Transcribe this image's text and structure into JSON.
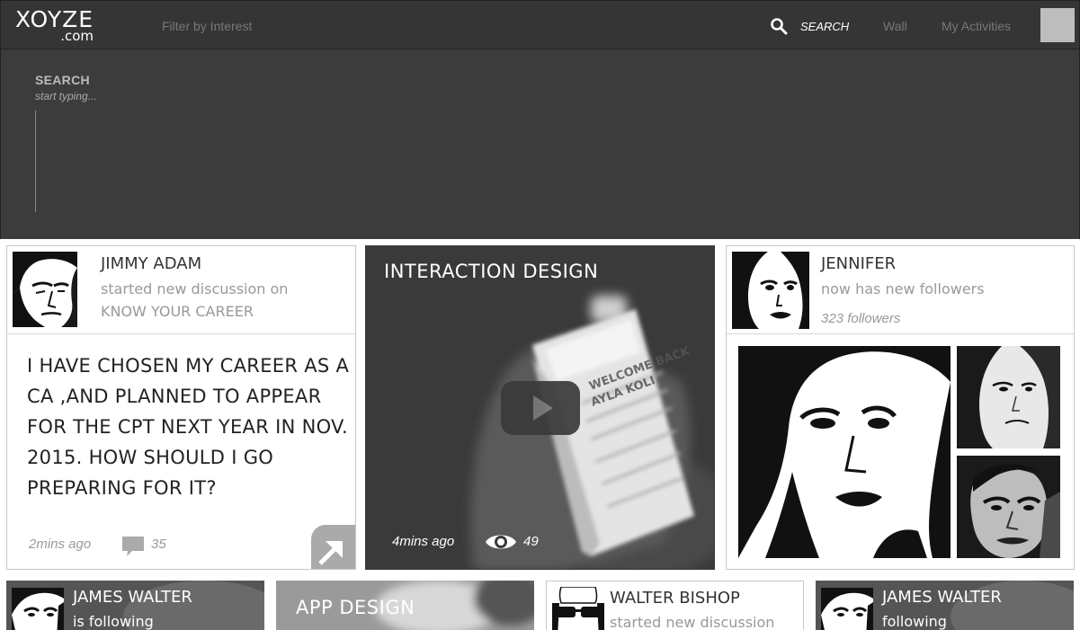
{
  "brand": {
    "name": "XOYZE",
    "domain": ".com"
  },
  "nav": {
    "filter_label": "Filter by Interest",
    "search_label": "SEARCH",
    "wall": "Wall",
    "activities": "My Activities"
  },
  "search_panel": {
    "label": "SEARCH",
    "placeholder": "start typing..."
  },
  "cards": [
    {
      "name": "JIMMY ADAM",
      "action": "started new discussion on",
      "topic": "KNOW YOUR CAREER",
      "question": "I HAVE CHOSEN MY CAREER AS A CA ,AND PLANNED TO APPEAR FOR THE CPT NEXT YEAR IN NOV. 2015. HOW SHOULD I GO PREPARING FOR IT?",
      "time": "2mins ago",
      "comments": "35"
    },
    {
      "title": "INTERACTION DESIGN",
      "time": "4mins ago",
      "views": "49"
    },
    {
      "name": "JENNIFER",
      "action": "now has new followers",
      "followers": "323 followers"
    }
  ],
  "bottom_cards": [
    {
      "name": "JAMES WALTER",
      "action": "is following"
    },
    {
      "title": "APP DESIGN"
    },
    {
      "name": "WALTER BISHOP",
      "action": "started new discussion"
    },
    {
      "name": "JAMES WALTER",
      "action": "following"
    }
  ],
  "colors": {
    "topbar": "#353535",
    "search_panel": "#3c3c3c",
    "video_card": "#3a3a3a",
    "muted_text": "#999999"
  }
}
